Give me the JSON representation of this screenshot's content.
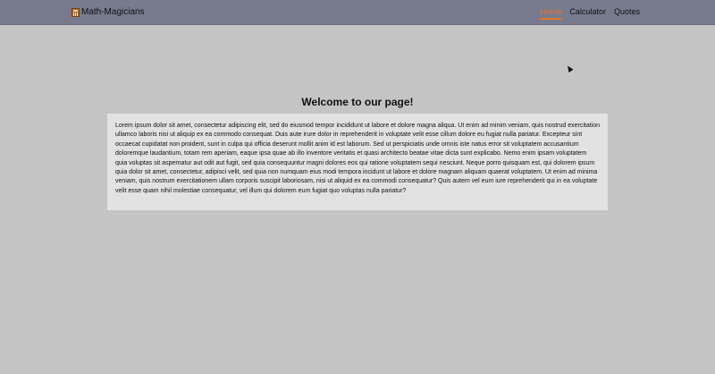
{
  "brand": {
    "name": "Math-Magicians",
    "icon": "calculator-icon"
  },
  "nav": {
    "items": [
      {
        "label": "Home",
        "active": true
      },
      {
        "label": "Calculator",
        "active": false
      },
      {
        "label": "Quotes",
        "active": false
      }
    ],
    "active_color": "#e8742a"
  },
  "page": {
    "title": "Welcome to our page!",
    "body": "Lorem ipsum dolor sit amet, consectetur adipiscing elit, sed do eiusmod tempor incididunt ut labore et dolore magna aliqua. Ut enim ad minim veniam, quis nostrud exercitation ullamco laboris nisi ut aliquip ex ea commodo consequat. Duis aute irure dolor in reprehenderit in voluptate velit esse cillum dolore eu fugiat nulla pariatur. Excepteur sint occaecat cupidatat non proident, sunt in culpa qui officia deserunt mollit anim id est laborum. Sed ut perspiciatis unde omnis iste natus error sit voluptatem accusantium doloremque laudantium, totam rem aperiam, eaque ipsa quae ab illo inventore veritatis et quasi architecto beatae vitae dicta sunt explicabo. Nemo enim ipsam voluptatem quia voluptas sit aspernatur aut odit aut fugit, sed quia consequuntur magni dolores eos qui ratione voluptatem sequi nesciunt. Neque porro quisquam est, qui dolorem ipsum quia dolor sit amet, consectetur, adipisci velit, sed quia non numquam eius modi tempora incidunt ut labore et dolore magnam aliquam quaerat voluptatem. Ut enim ad minima veniam, quis nostrum exercitationem ullam corporis suscipit laboriosam, nisi ut aliquid ex ea commodi consequatur? Quis autem vel eum iure reprehenderit qui in ea voluptate velit esse quam nihil molestiae consequatur, vel illum qui dolorem eum fugiat quo voluptas nulla pariatur?"
  }
}
